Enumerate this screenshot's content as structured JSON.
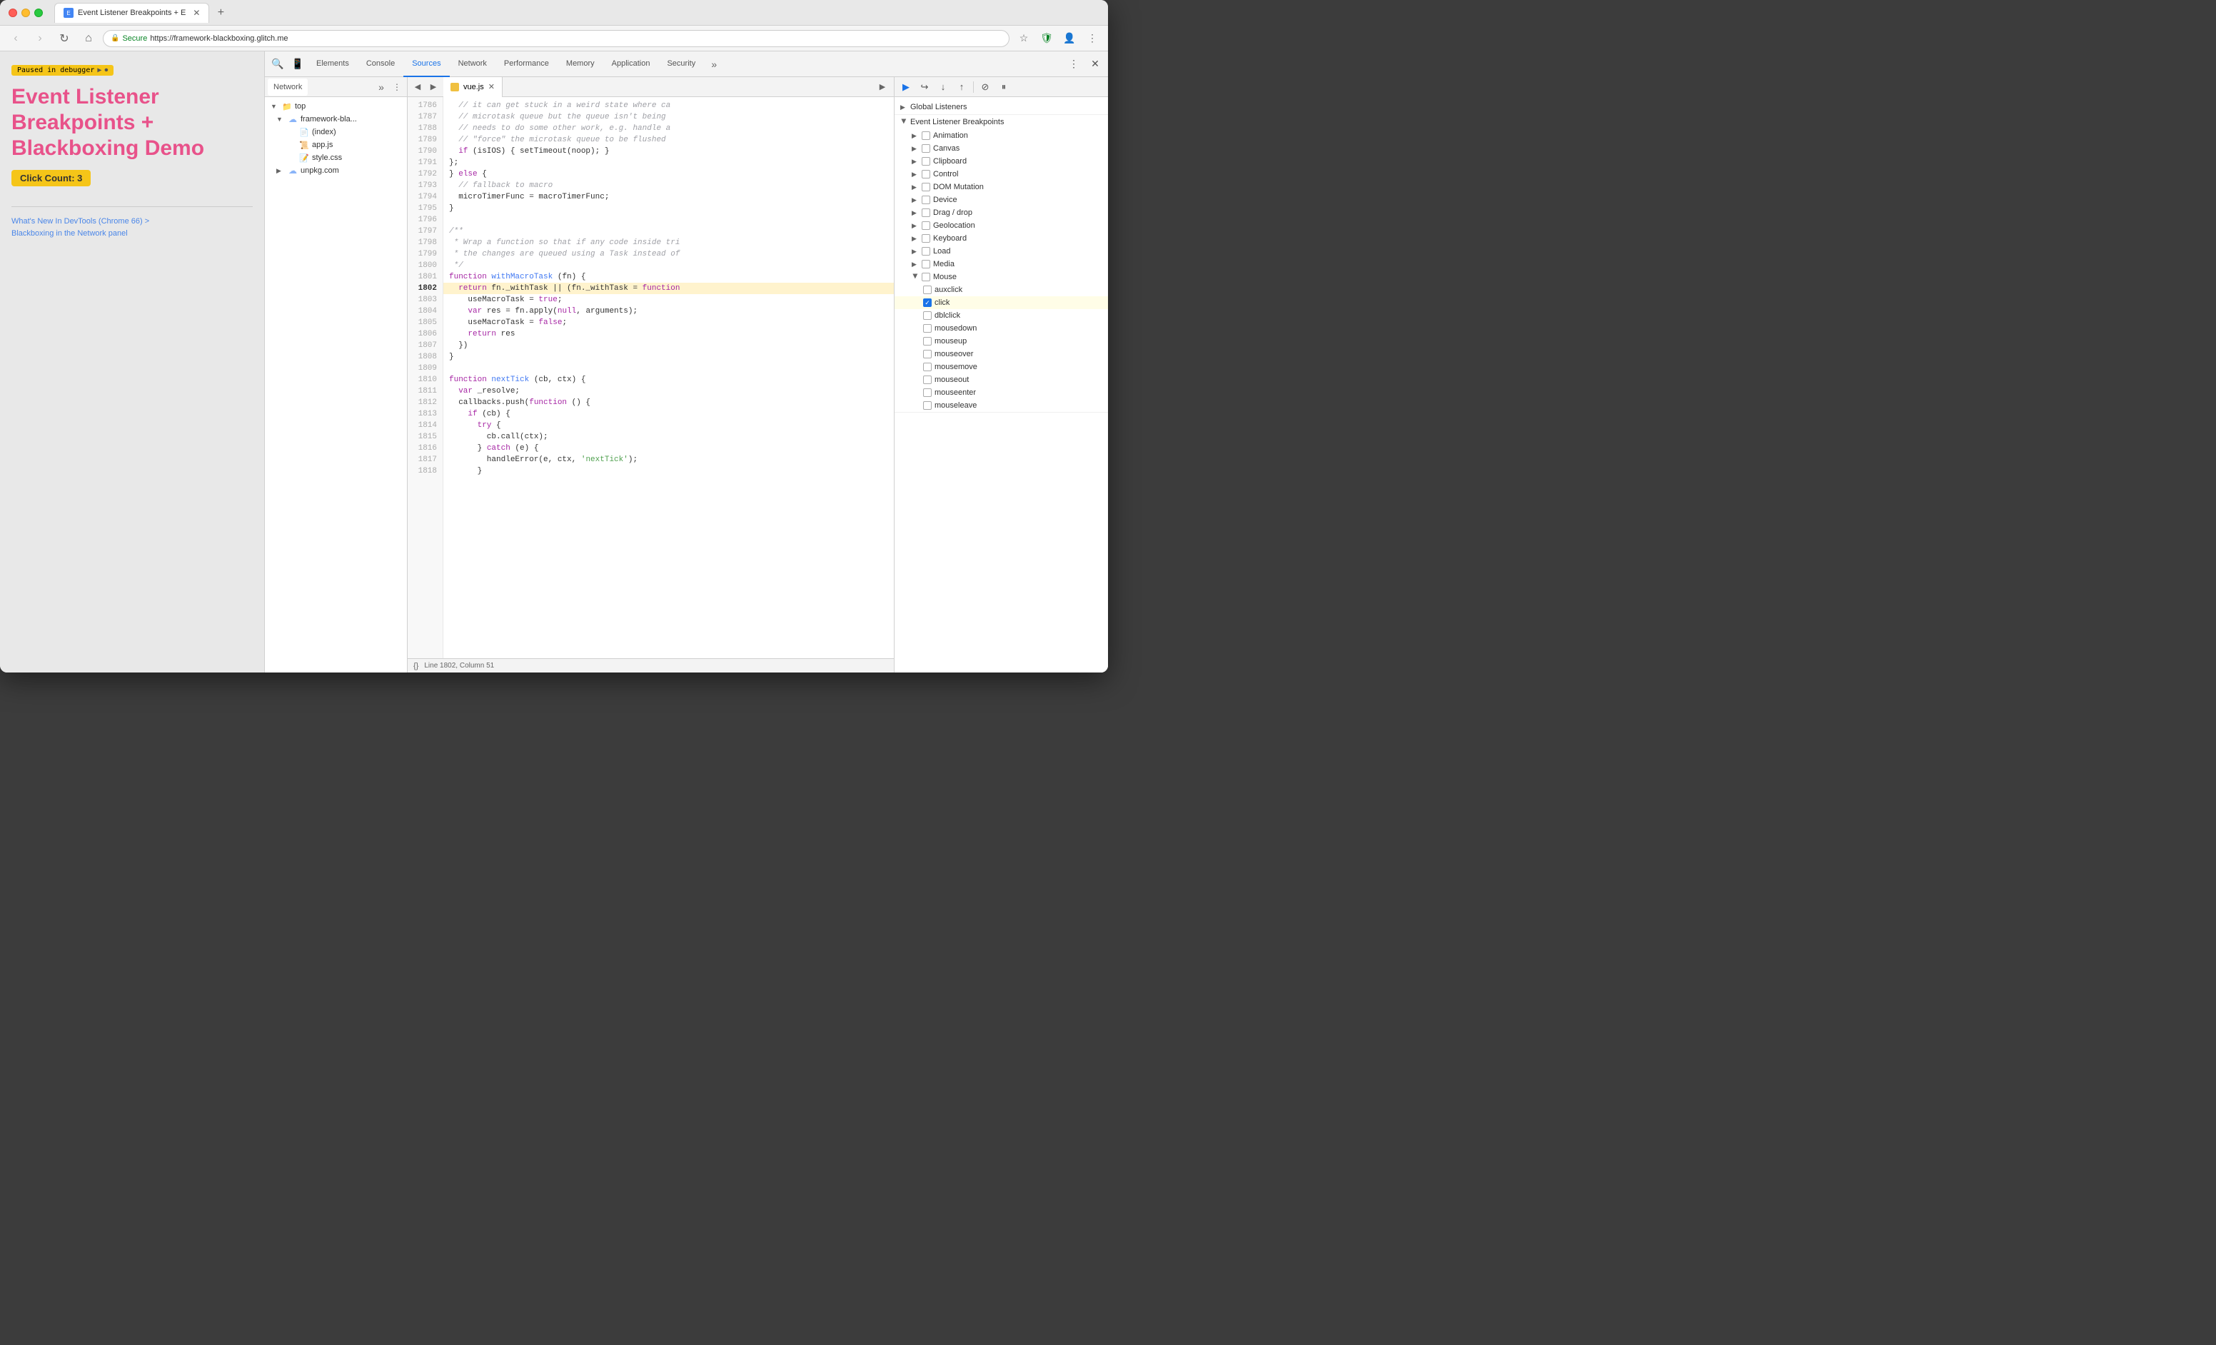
{
  "browser": {
    "tabs": [
      {
        "label": "Event Listener Breakpoints + E",
        "active": true
      },
      {
        "label": "",
        "active": false
      }
    ],
    "address": {
      "secure_label": "Secure",
      "url": "https://framework-blackboxing.glitch.me"
    },
    "nav": {
      "back": "‹",
      "forward": "›",
      "refresh": "↻",
      "home": "⌂"
    }
  },
  "page": {
    "paused_label": "Paused in debugger",
    "title": "Event Listener Breakpoints + Blackboxing Demo",
    "click_count": "Click Count: 3",
    "link1": "What's New In DevTools (Chrome 66) >",
    "link2": "Blackboxing in the Network panel"
  },
  "devtools": {
    "tabs": [
      {
        "label": "Elements",
        "active": false
      },
      {
        "label": "Console",
        "active": false
      },
      {
        "label": "Sources",
        "active": true
      },
      {
        "label": "Network",
        "active": false
      },
      {
        "label": "Performance",
        "active": false
      },
      {
        "label": "Memory",
        "active": false
      },
      {
        "label": "Application",
        "active": false
      },
      {
        "label": "Security",
        "active": false
      }
    ],
    "toolbar_buttons": [
      "▶",
      "⟳",
      "↓",
      "↑",
      "⊘",
      "⏸"
    ]
  },
  "file_tree": {
    "tab": "Network",
    "items": [
      {
        "indent": 0,
        "arrow": "▼",
        "icon": "folder",
        "label": "top"
      },
      {
        "indent": 1,
        "arrow": "▼",
        "icon": "cloud",
        "label": "framework-bla..."
      },
      {
        "indent": 2,
        "arrow": "",
        "icon": "file",
        "label": "(index)"
      },
      {
        "indent": 2,
        "arrow": "",
        "icon": "js",
        "label": "app.js"
      },
      {
        "indent": 2,
        "arrow": "",
        "icon": "css",
        "label": "style.css"
      },
      {
        "indent": 1,
        "arrow": "▶",
        "icon": "cloud",
        "label": "unpkg.com"
      }
    ]
  },
  "editor": {
    "filename": "vue.js",
    "status": "Line 1802, Column 51",
    "lines": [
      {
        "num": 1786,
        "code": "  // it can get stuck in a weird state where ca",
        "type": "comment"
      },
      {
        "num": 1787,
        "code": "  // microtask queue but the queue isn't being",
        "type": "comment"
      },
      {
        "num": 1788,
        "code": "  // needs to do some other work, e.g. handle a",
        "type": "comment"
      },
      {
        "num": 1789,
        "code": "  // \"force\" the microtask queue to be flushed",
        "type": "comment"
      },
      {
        "num": 1790,
        "code": "  if (isIOS) { setTimeout(noop); }",
        "type": "code"
      },
      {
        "num": 1791,
        "code": "};",
        "type": "code"
      },
      {
        "num": 1792,
        "code": "} else {",
        "type": "code"
      },
      {
        "num": 1793,
        "code": "  // fallback to macro",
        "type": "comment"
      },
      {
        "num": 1794,
        "code": "  microTimerFunc = macroTimerFunc;",
        "type": "code"
      },
      {
        "num": 1795,
        "code": "}",
        "type": "code"
      },
      {
        "num": 1796,
        "code": "",
        "type": "code"
      },
      {
        "num": 1797,
        "code": "/**",
        "type": "comment"
      },
      {
        "num": 1798,
        "code": " * Wrap a function so that if any code inside tri",
        "type": "comment"
      },
      {
        "num": 1799,
        "code": " * the changes are queued using a Task instead of",
        "type": "comment"
      },
      {
        "num": 1800,
        "code": " */",
        "type": "comment"
      },
      {
        "num": 1801,
        "code": "function withMacroTask (fn) {",
        "type": "code"
      },
      {
        "num": 1802,
        "code": "  return fn._withTask || (fn._withTask = function",
        "type": "highlight"
      },
      {
        "num": 1803,
        "code": "    useMacroTask = true;",
        "type": "code"
      },
      {
        "num": 1804,
        "code": "    var res = fn.apply(null, arguments);",
        "type": "code"
      },
      {
        "num": 1805,
        "code": "    useMacroTask = false;",
        "type": "code"
      },
      {
        "num": 1806,
        "code": "    return res",
        "type": "code"
      },
      {
        "num": 1807,
        "code": "  })",
        "type": "code"
      },
      {
        "num": 1808,
        "code": "}",
        "type": "code"
      },
      {
        "num": 1809,
        "code": "",
        "type": "code"
      },
      {
        "num": 1810,
        "code": "function nextTick (cb, ctx) {",
        "type": "code"
      },
      {
        "num": 1811,
        "code": "  var _resolve;",
        "type": "code"
      },
      {
        "num": 1812,
        "code": "  callbacks.push(function () {",
        "type": "code"
      },
      {
        "num": 1813,
        "code": "    if (cb) {",
        "type": "code"
      },
      {
        "num": 1814,
        "code": "      try {",
        "type": "code"
      },
      {
        "num": 1815,
        "code": "        cb.call(ctx);",
        "type": "code"
      },
      {
        "num": 1816,
        "code": "      } catch (e) {",
        "type": "code"
      },
      {
        "num": 1817,
        "code": "        handleError(e, ctx, 'nextTick');",
        "type": "code"
      },
      {
        "num": 1818,
        "code": "      }",
        "type": "code"
      }
    ]
  },
  "breakpoints": {
    "global_listeners_label": "Global Listeners",
    "event_listener_breakpoints_label": "Event Listener Breakpoints",
    "sections": [
      {
        "label": "Animation",
        "checked": false,
        "open": false
      },
      {
        "label": "Canvas",
        "checked": false,
        "open": false
      },
      {
        "label": "Clipboard",
        "checked": false,
        "open": false
      },
      {
        "label": "Control",
        "checked": false,
        "open": false
      },
      {
        "label": "DOM Mutation",
        "checked": false,
        "open": false
      },
      {
        "label": "Device",
        "checked": false,
        "open": false
      },
      {
        "label": "Drag / drop",
        "checked": false,
        "open": false
      },
      {
        "label": "Geolocation",
        "checked": false,
        "open": false
      },
      {
        "label": "Keyboard",
        "checked": false,
        "open": false
      },
      {
        "label": "Load",
        "checked": false,
        "open": false
      },
      {
        "label": "Media",
        "checked": false,
        "open": false
      },
      {
        "label": "Mouse",
        "checked": false,
        "open": true,
        "items": [
          {
            "label": "auxclick",
            "checked": false,
            "highlighted": false
          },
          {
            "label": "click",
            "checked": true,
            "highlighted": true
          },
          {
            "label": "dblclick",
            "checked": false,
            "highlighted": false
          },
          {
            "label": "mousedown",
            "checked": false,
            "highlighted": false
          },
          {
            "label": "mouseup",
            "checked": false,
            "highlighted": false
          },
          {
            "label": "mouseover",
            "checked": false,
            "highlighted": false
          },
          {
            "label": "mousemove",
            "checked": false,
            "highlighted": false
          },
          {
            "label": "mouseout",
            "checked": false,
            "highlighted": false
          },
          {
            "label": "mouseenter",
            "checked": false,
            "highlighted": false
          },
          {
            "label": "mouseleave",
            "checked": false,
            "highlighted": false
          }
        ]
      }
    ]
  }
}
